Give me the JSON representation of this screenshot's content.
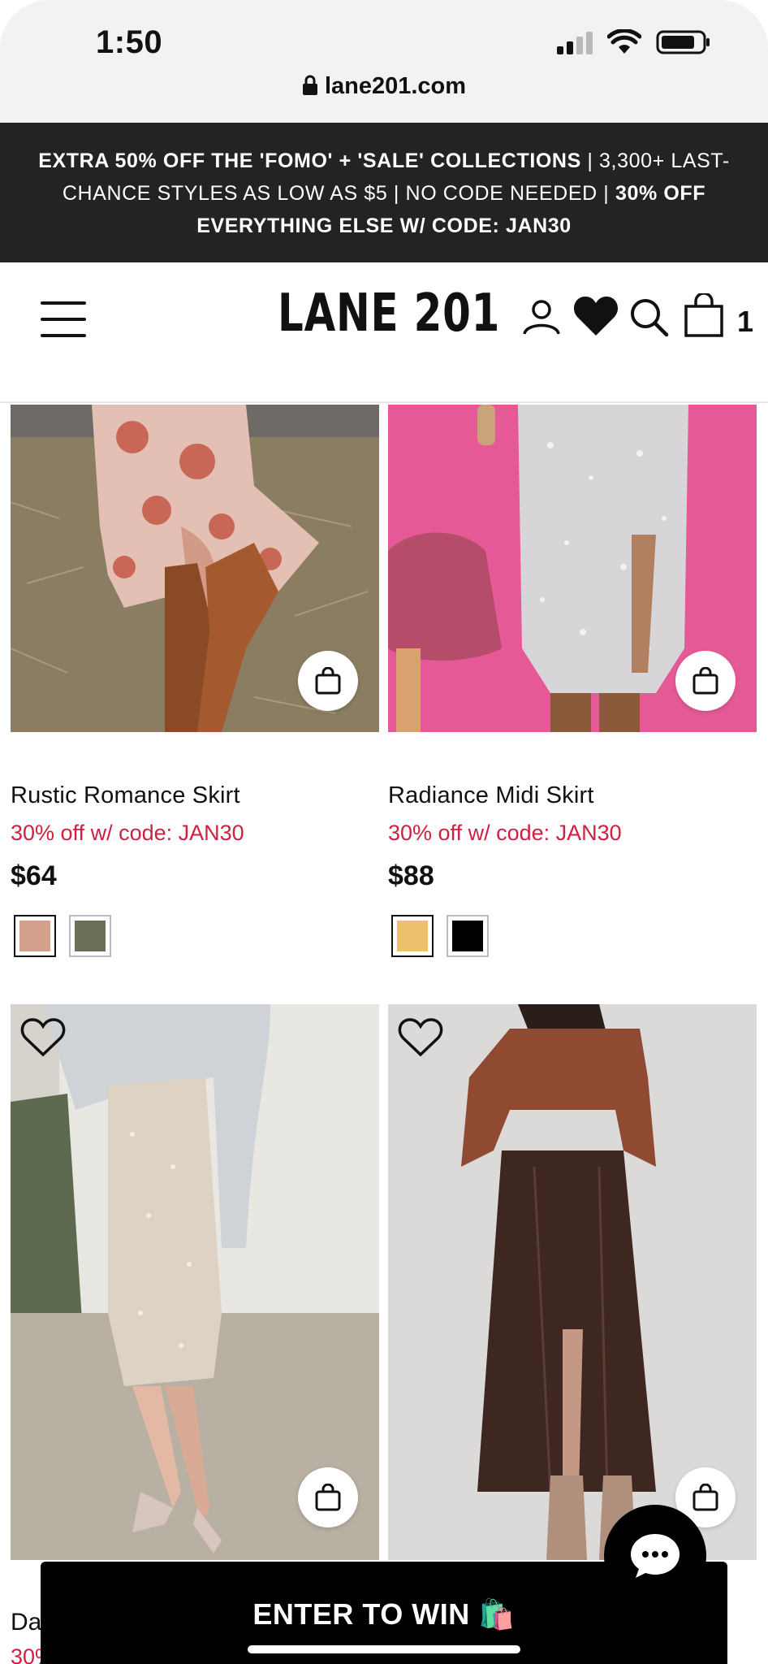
{
  "status_bar": {
    "time": "1:50"
  },
  "browser": {
    "url": "lane201.com"
  },
  "promo_banner": {
    "line1_bold": "EXTRA 50% OFF THE 'FOMO' + 'SALE' COLLECTIONS",
    "line1_rest": " | 3,300+ LAST-CHANCE STYLES AS LOW AS $5 | NO CODE NEEDED | ",
    "line2_bold": "30% OFF EVERYTHING ELSE W/ CODE: JAN30"
  },
  "header": {
    "logo": "LANE 201",
    "cart_count": "1"
  },
  "products": [
    {
      "name": "Rustic Romance Skirt",
      "promo": "30% off w/ code: JAN30",
      "price": "$64",
      "swatches": [
        "#d4a08b",
        "#6b6f57"
      ]
    },
    {
      "name": "Radiance Midi Skirt",
      "promo": "30% off w/ code: JAN30",
      "price": "$88",
      "swatches": [
        "#eec06b",
        "#000000"
      ]
    },
    {
      "name": "Da",
      "promo": "30%"
    }
  ],
  "bottom": {
    "enter_label": "ENTER TO WIN 🛍️"
  },
  "colors": {
    "promo_red": "#d01f42",
    "banner_bg": "#232323"
  }
}
